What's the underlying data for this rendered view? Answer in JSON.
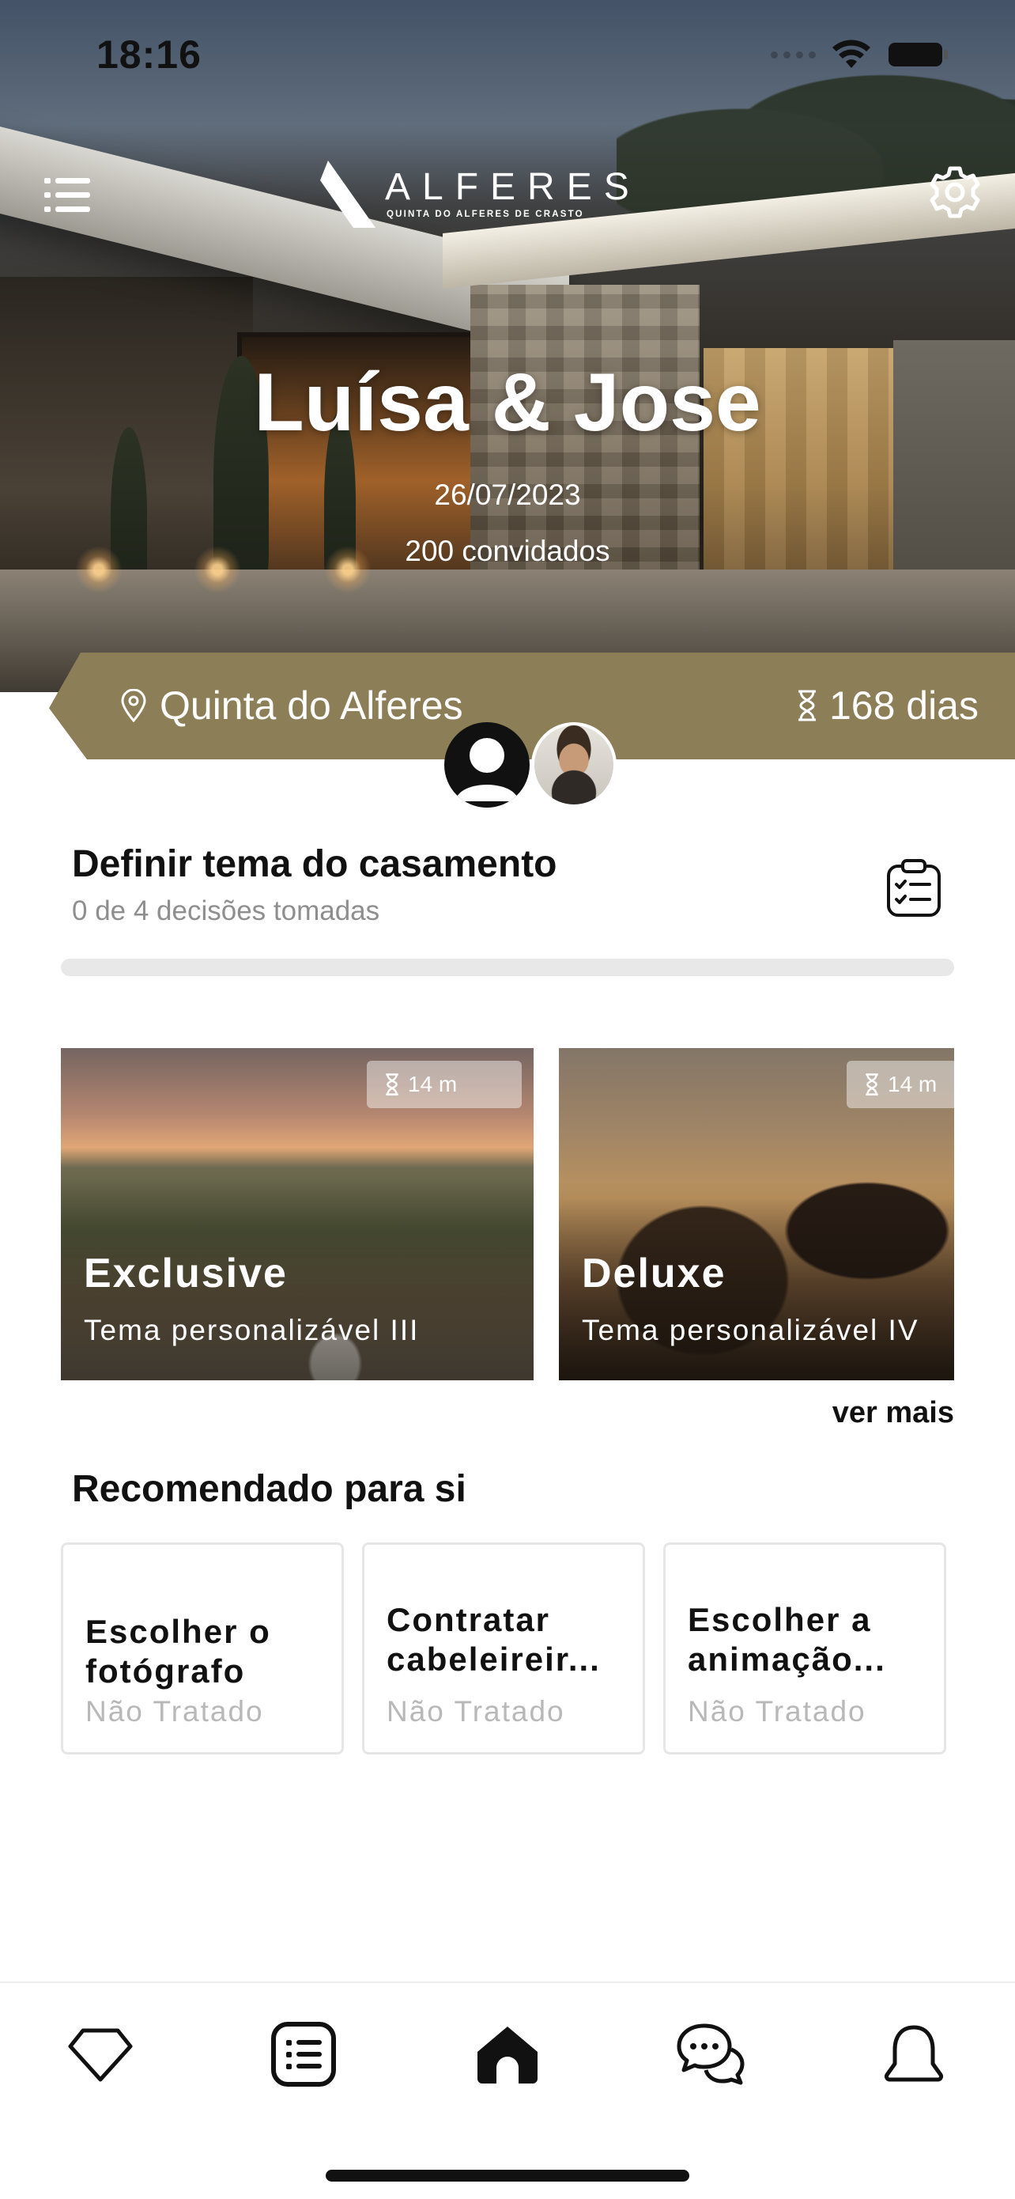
{
  "status_bar": {
    "time": "18:16"
  },
  "brand": {
    "name": "ALFERES",
    "subtitle": "QUINTA DO ALFERES DE CRASTO"
  },
  "event": {
    "couple": "Luísa & Jose",
    "date": "26/07/2023",
    "guests": "200 convidados",
    "location": "Quinta do Alferes",
    "countdown": "168 dias"
  },
  "theme_section": {
    "title": "Definir tema do casamento",
    "subtitle": "0 de 4 decisões tomadas",
    "progress_fraction": 0
  },
  "theme_cards": [
    {
      "title": "Exclusive",
      "subtitle": "Tema personalizável III",
      "timer": "14 m"
    },
    {
      "title": "Deluxe",
      "subtitle": "Tema personalizável IV",
      "timer": "14 m"
    }
  ],
  "see_more": "ver mais",
  "recommended": {
    "title": "Recomendado para si",
    "items": [
      {
        "label": "Escolher o fotógrafo",
        "status": "Não Tratado"
      },
      {
        "label": "Contratar cabeleireir...",
        "status": "Não Tratado"
      },
      {
        "label": "Escolher a animação...",
        "status": "Não Tratado"
      }
    ]
  },
  "tabs": [
    {
      "icon": "diamond-icon"
    },
    {
      "icon": "checklist-icon"
    },
    {
      "icon": "home-icon",
      "active": true
    },
    {
      "icon": "chat-icon"
    },
    {
      "icon": "bell-icon"
    }
  ],
  "colors": {
    "accent_gold": "#8c7e57",
    "progress_track": "#e8e8e8"
  }
}
